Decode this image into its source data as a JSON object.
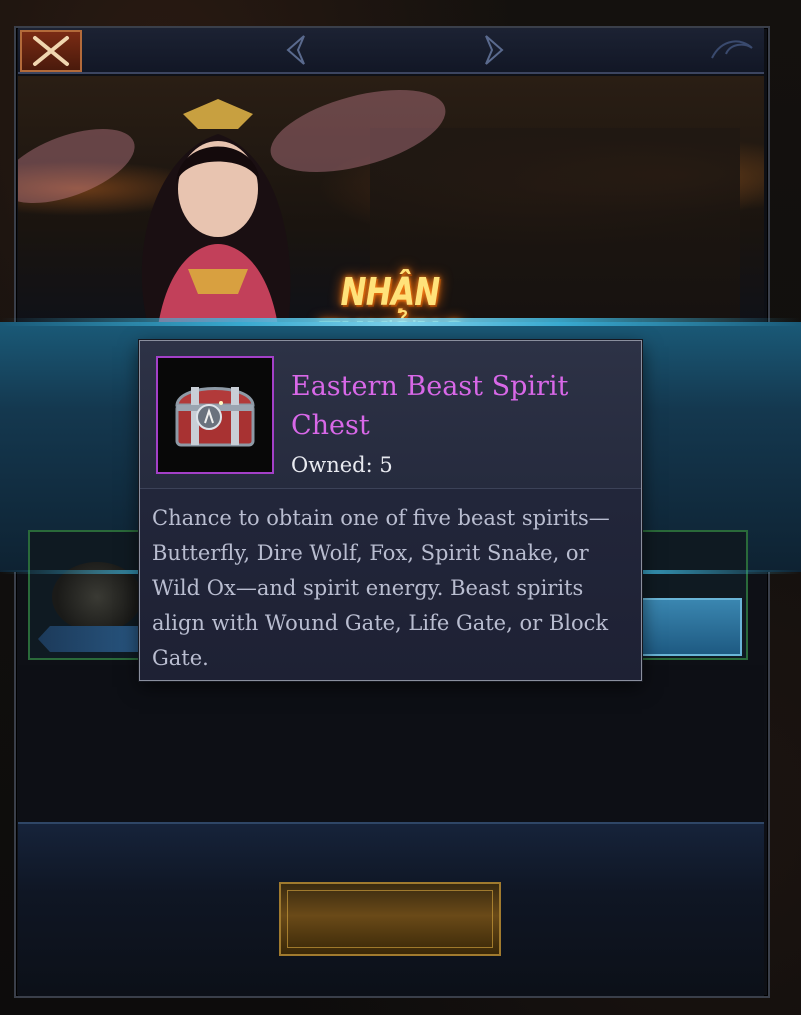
{
  "header": {
    "close_icon": "close-x-icon"
  },
  "banner": {
    "title": "NHẬN THƯỞNG"
  },
  "tooltip": {
    "item_name": "Eastern Beast Spirit Chest",
    "owned_label": "Owned:",
    "owned_value": "5",
    "description": "Chance to obtain one of five beast spirits—Butterfly, Dire Wolf, Fox, Spirit Snake, or Wild Ox—and spirit energy. Beast spirits align with Wound Gate, Life Gate, or Block Gate.",
    "item_icon": "treasure-chest-icon",
    "rarity_color": "#a340c8",
    "name_color": "#d868e8"
  },
  "footer": {
    "claim_button_label": ""
  }
}
